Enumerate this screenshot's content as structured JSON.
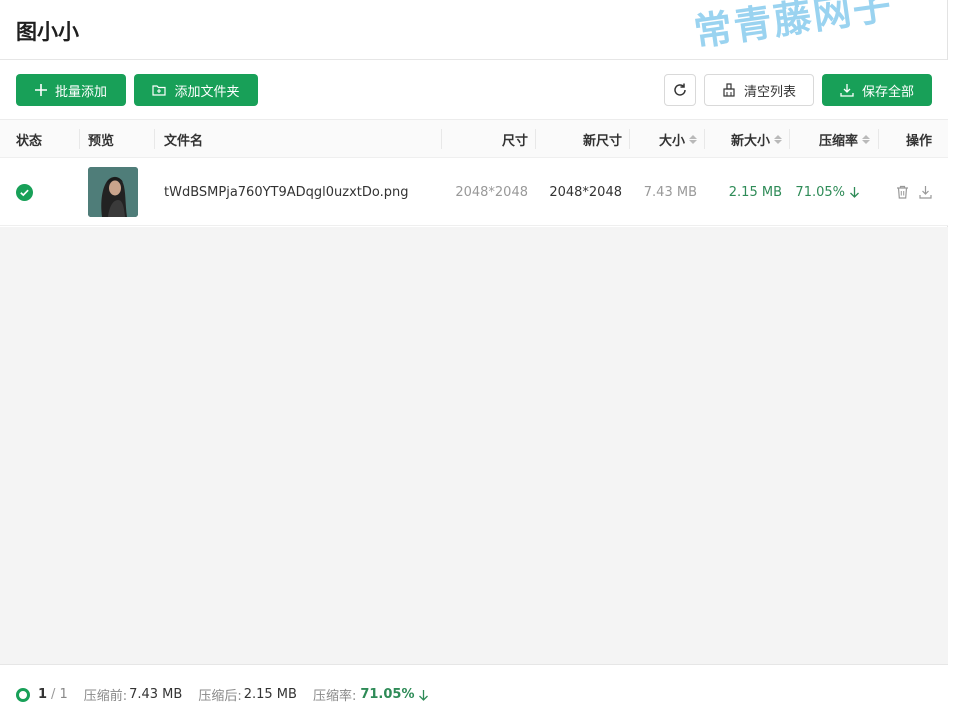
{
  "app": {
    "title": "图小小"
  },
  "watermark": "常青藤网子",
  "toolbar": {
    "batch_add": "批量添加",
    "add_folder": "添加文件夹",
    "clear_list": "清空列表",
    "save_all": "保存全部"
  },
  "columns": {
    "status": "状态",
    "preview": "预览",
    "filename": "文件名",
    "size": "尺寸",
    "new_size": "新尺寸",
    "file_size": "大小",
    "new_file_size": "新大小",
    "ratio": "压缩率",
    "actions": "操作"
  },
  "files": [
    {
      "status": "done",
      "name": "tWdBSMPja760YT9ADqgl0uzxtDo.png",
      "size": "2048*2048",
      "new_size": "2048*2048",
      "file_size": "7.43 MB",
      "new_file_size": "2.15 MB",
      "ratio": "71.05%"
    }
  ],
  "footer": {
    "progress_current": "1",
    "progress_total": "1",
    "before_label": "压缩前:",
    "before_value": "7.43 MB",
    "after_label": "压缩后:",
    "after_value": "2.15 MB",
    "ratio_label": "压缩率:",
    "ratio_value": "71.05%"
  },
  "colors": {
    "accent": "#18a058",
    "success_text": "#2e8b57",
    "watermark": "#9ad3f0"
  },
  "icons": {
    "batch_add": "plus-icon",
    "add_folder": "folder-icon",
    "refresh": "refresh-icon",
    "clear": "broom-icon",
    "save": "download-icon",
    "status": "check-circle-icon",
    "delete": "trash-icon",
    "download": "download-icon",
    "ratio": "arrow-down-icon"
  }
}
